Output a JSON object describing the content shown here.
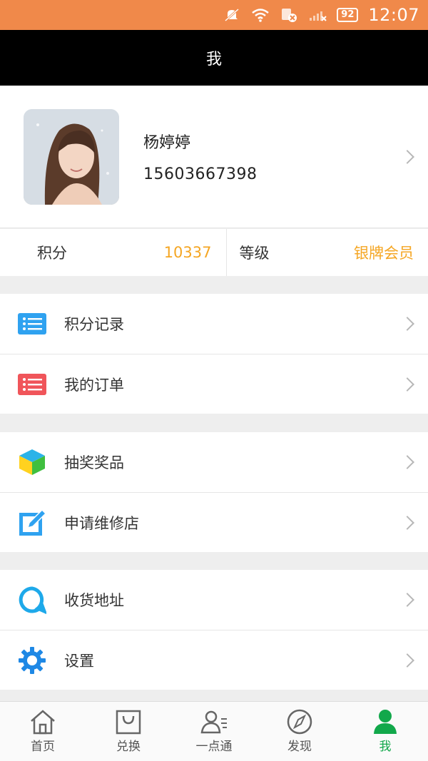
{
  "status_bar": {
    "battery": "92",
    "time": "12:07",
    "icons": [
      "mute-icon",
      "wifi-icon",
      "sim-off-icon",
      "signal-icon",
      "battery-icon"
    ]
  },
  "header": {
    "title": "我"
  },
  "profile": {
    "name": "杨婷婷",
    "phone": "15603667398"
  },
  "stats": {
    "points_label": "积分",
    "points_value": "10337",
    "level_label": "等级",
    "level_value": "银牌会员"
  },
  "menu": {
    "group1": [
      {
        "label": "积分记录",
        "icon": "list-blue-icon"
      },
      {
        "label": "我的订单",
        "icon": "list-red-icon"
      }
    ],
    "group2": [
      {
        "label": "抽奖奖品",
        "icon": "cube-icon"
      },
      {
        "label": "申请维修店",
        "icon": "edit-icon"
      }
    ],
    "group3": [
      {
        "label": "收货地址",
        "icon": "location-bubble-icon"
      },
      {
        "label": "设置",
        "icon": "gear-icon"
      }
    ]
  },
  "tabs": [
    {
      "label": "首页",
      "icon": "home-icon"
    },
    {
      "label": "兑换",
      "icon": "bag-icon"
    },
    {
      "label": "一点通",
      "icon": "contacts-icon"
    },
    {
      "label": "发现",
      "icon": "compass-icon"
    },
    {
      "label": "我",
      "icon": "user-icon",
      "active": true
    }
  ],
  "colors": {
    "status_bar": "#f0894a",
    "accent_orange": "#f5a623",
    "active_tab": "#12a84b",
    "title_bar": "#000000"
  }
}
